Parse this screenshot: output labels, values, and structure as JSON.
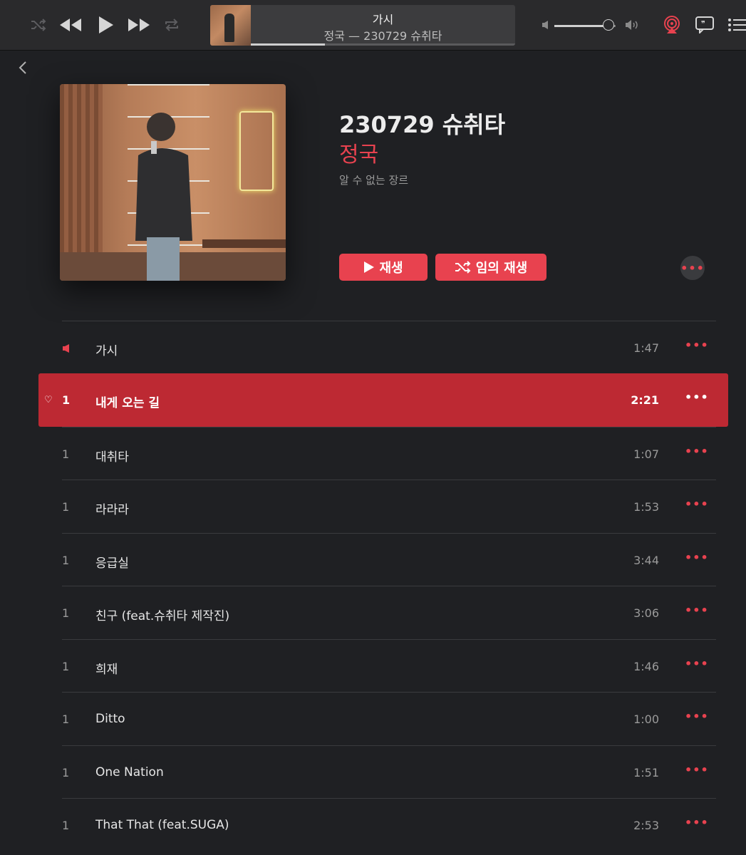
{
  "now_playing": {
    "title": "가시",
    "subtitle": "정국 — 230729 슈취타",
    "progress": 0.28
  },
  "volume": {
    "level": 0.88
  },
  "album": {
    "title": "230729 슈취타",
    "artist": "정국",
    "genre": "알 수 없는 장르"
  },
  "buttons": {
    "play_label": "재생",
    "shuffle_label": "임의 재생",
    "more_label": "•••"
  },
  "tracks": [
    {
      "num": "",
      "title": "가시",
      "duration": "1:47",
      "playing": true
    },
    {
      "num": "1",
      "title": "내게 오는 길",
      "duration": "2:21",
      "selected": true
    },
    {
      "num": "1",
      "title": "대취타",
      "duration": "1:07"
    },
    {
      "num": "1",
      "title": "라라라",
      "duration": "1:53"
    },
    {
      "num": "1",
      "title": "응급실",
      "duration": "3:44"
    },
    {
      "num": "1",
      "title": "친구 (feat.슈취타 제작진)",
      "duration": "3:06"
    },
    {
      "num": "1",
      "title": "희재",
      "duration": "1:46"
    },
    {
      "num": "1",
      "title": "Ditto",
      "duration": "1:00"
    },
    {
      "num": "1",
      "title": "One Nation",
      "duration": "1:51"
    },
    {
      "num": "1",
      "title": "That That (feat.SUGA)",
      "duration": "2:53"
    }
  ],
  "colors": {
    "accent": "#e8424f",
    "selected_row": "#bd2933",
    "background": "#1f2023"
  },
  "icons": [
    "shuffle-icon",
    "rewind-icon",
    "play-icon",
    "fast-forward-icon",
    "repeat-icon",
    "volume-low-icon",
    "volume-high-icon",
    "airplay-icon",
    "lyrics-icon",
    "queue-list-icon",
    "back-chevron-icon",
    "speaker-icon",
    "heart-icon",
    "more-icon"
  ]
}
